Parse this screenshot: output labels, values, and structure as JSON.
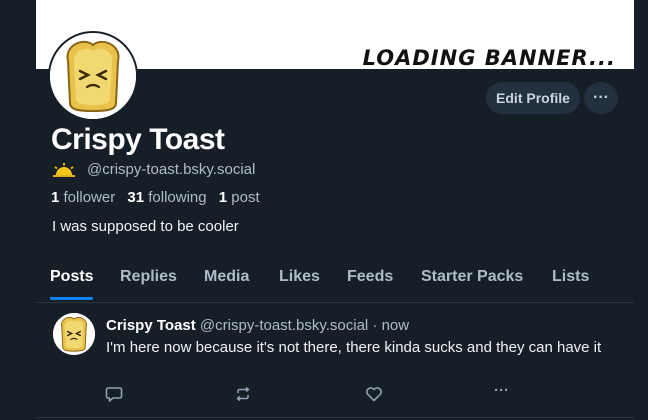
{
  "banner": {
    "text": "LOADING BANNER..."
  },
  "profile": {
    "display_name": "Crispy Toast",
    "handle": "@crispy-toast.bsky.social",
    "followers_count": "1",
    "followers_label": "follower",
    "following_count": "31",
    "following_label": "following",
    "posts_count": "1",
    "posts_label": "post",
    "bio": "I was supposed to be cooler"
  },
  "actions": {
    "edit_profile": "Edit Profile",
    "more": "···"
  },
  "tabs": [
    {
      "label": "Posts",
      "active": true
    },
    {
      "label": "Replies"
    },
    {
      "label": "Media"
    },
    {
      "label": "Likes"
    },
    {
      "label": "Feeds"
    },
    {
      "label": "Starter Packs"
    },
    {
      "label": "Lists"
    }
  ],
  "post": {
    "author_name": "Crispy Toast",
    "author_handle": "@crispy-toast.bsky.social",
    "separator": "·",
    "time": "now",
    "text": "I'm here now because it's not there, there kinda sucks and they can have it",
    "more": "···"
  },
  "colors": {
    "accent": "#1083fe",
    "background": "#161e27",
    "button": "#233040"
  },
  "icons": [
    "sun-icon",
    "reply-icon",
    "repost-icon",
    "like-icon",
    "more-icon"
  ]
}
